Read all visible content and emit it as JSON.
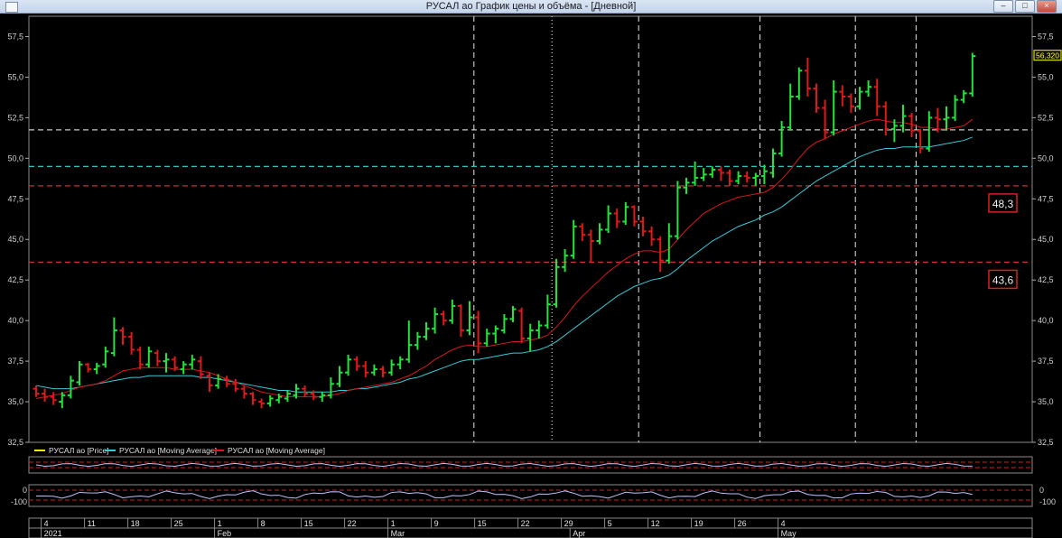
{
  "window": {
    "title": "РУСАЛ ао График цены и объёма - [Дневной]",
    "controls": [
      "–",
      "□",
      "×"
    ]
  },
  "colors": {
    "background": "#000000",
    "up": "#22e43a",
    "down": "#e01818",
    "ma_fast": "#d8191b",
    "ma_slow": "#38c9d8",
    "level_cyan": "#3ad8e0",
    "level_red": "#c83030",
    "level_grey": "#c8c8c8",
    "price_marker": "#ffff00"
  },
  "chart_data": {
    "type": "ohlc",
    "ylim": [
      32.5,
      58.75
    ],
    "yticks": [
      "57,5",
      "55,0",
      "52,5",
      "50,0",
      "47,5",
      "45,0",
      "42,5",
      "40,0",
      "37,5",
      "35,0",
      "32,5"
    ],
    "yticks_values": [
      57.5,
      55.0,
      52.5,
      50.0,
      47.5,
      45.0,
      42.5,
      40.0,
      37.5,
      35.0,
      32.5
    ],
    "last_price_label": "56,320",
    "last_price": 56.32,
    "bars": [
      {
        "o": 35.8,
        "h": 36.0,
        "l": 35.3,
        "c": 35.5
      },
      {
        "o": 35.5,
        "h": 35.8,
        "l": 35.0,
        "c": 35.3
      },
      {
        "o": 35.3,
        "h": 35.6,
        "l": 34.8,
        "c": 35.1
      },
      {
        "o": 35.0,
        "h": 35.6,
        "l": 34.6,
        "c": 35.4
      },
      {
        "o": 35.4,
        "h": 36.6,
        "l": 35.2,
        "c": 36.3
      },
      {
        "o": 36.2,
        "h": 37.5,
        "l": 36.0,
        "c": 37.3
      },
      {
        "o": 37.3,
        "h": 37.4,
        "l": 36.8,
        "c": 37.0
      },
      {
        "o": 37.0,
        "h": 37.4,
        "l": 36.7,
        "c": 37.2
      },
      {
        "o": 37.3,
        "h": 38.4,
        "l": 37.1,
        "c": 38.1
      },
      {
        "o": 38.0,
        "h": 40.2,
        "l": 37.8,
        "c": 39.4
      },
      {
        "o": 39.4,
        "h": 39.6,
        "l": 38.5,
        "c": 39.0
      },
      {
        "o": 39.0,
        "h": 39.3,
        "l": 37.9,
        "c": 38.2
      },
      {
        "o": 38.2,
        "h": 38.4,
        "l": 37.0,
        "c": 37.3
      },
      {
        "o": 37.3,
        "h": 38.4,
        "l": 37.1,
        "c": 38.1
      },
      {
        "o": 38.0,
        "h": 38.2,
        "l": 37.2,
        "c": 37.5
      },
      {
        "o": 37.5,
        "h": 38.0,
        "l": 36.8,
        "c": 37.6
      },
      {
        "o": 37.6,
        "h": 37.8,
        "l": 36.9,
        "c": 37.1
      },
      {
        "o": 37.0,
        "h": 37.5,
        "l": 36.7,
        "c": 37.3
      },
      {
        "o": 37.3,
        "h": 37.9,
        "l": 37.0,
        "c": 37.6
      },
      {
        "o": 37.5,
        "h": 37.8,
        "l": 36.4,
        "c": 36.7
      },
      {
        "o": 36.6,
        "h": 36.8,
        "l": 35.6,
        "c": 36.0
      },
      {
        "o": 36.0,
        "h": 36.7,
        "l": 35.8,
        "c": 36.4
      },
      {
        "o": 36.4,
        "h": 36.6,
        "l": 35.9,
        "c": 36.1
      },
      {
        "o": 36.1,
        "h": 36.4,
        "l": 35.6,
        "c": 35.8
      },
      {
        "o": 35.8,
        "h": 36.0,
        "l": 35.2,
        "c": 35.5
      },
      {
        "o": 35.5,
        "h": 35.6,
        "l": 34.8,
        "c": 35.1
      },
      {
        "o": 35.0,
        "h": 35.2,
        "l": 34.6,
        "c": 34.9
      },
      {
        "o": 34.9,
        "h": 35.4,
        "l": 34.7,
        "c": 35.2
      },
      {
        "o": 35.1,
        "h": 35.5,
        "l": 34.9,
        "c": 35.3
      },
      {
        "o": 35.2,
        "h": 35.7,
        "l": 35.0,
        "c": 35.5
      },
      {
        "o": 35.4,
        "h": 36.1,
        "l": 35.2,
        "c": 35.8
      },
      {
        "o": 35.8,
        "h": 36.0,
        "l": 35.3,
        "c": 35.5
      },
      {
        "o": 35.5,
        "h": 35.7,
        "l": 35.1,
        "c": 35.3
      },
      {
        "o": 35.3,
        "h": 35.6,
        "l": 35.0,
        "c": 35.4
      },
      {
        "o": 35.4,
        "h": 36.5,
        "l": 35.2,
        "c": 36.1
      },
      {
        "o": 36.1,
        "h": 37.2,
        "l": 35.9,
        "c": 36.8
      },
      {
        "o": 36.8,
        "h": 37.9,
        "l": 36.6,
        "c": 37.6
      },
      {
        "o": 37.6,
        "h": 37.8,
        "l": 36.9,
        "c": 37.2
      },
      {
        "o": 37.2,
        "h": 37.5,
        "l": 36.5,
        "c": 36.8
      },
      {
        "o": 36.8,
        "h": 37.3,
        "l": 36.6,
        "c": 37.0
      },
      {
        "o": 37.0,
        "h": 37.2,
        "l": 36.5,
        "c": 36.8
      },
      {
        "o": 36.8,
        "h": 37.6,
        "l": 36.6,
        "c": 37.3
      },
      {
        "o": 37.3,
        "h": 37.8,
        "l": 37.0,
        "c": 37.6
      },
      {
        "o": 37.6,
        "h": 40.0,
        "l": 37.4,
        "c": 38.5
      },
      {
        "o": 38.5,
        "h": 39.3,
        "l": 38.2,
        "c": 39.0
      },
      {
        "o": 39.0,
        "h": 39.9,
        "l": 38.8,
        "c": 39.5
      },
      {
        "o": 39.5,
        "h": 40.8,
        "l": 39.2,
        "c": 40.4
      },
      {
        "o": 40.4,
        "h": 40.6,
        "l": 39.7,
        "c": 40.0
      },
      {
        "o": 40.0,
        "h": 41.3,
        "l": 39.8,
        "c": 40.9
      },
      {
        "o": 40.9,
        "h": 41.0,
        "l": 39.0,
        "c": 39.4
      },
      {
        "o": 39.4,
        "h": 41.2,
        "l": 39.1,
        "c": 40.2
      },
      {
        "o": 40.2,
        "h": 40.6,
        "l": 38.0,
        "c": 38.6
      },
      {
        "o": 38.6,
        "h": 39.5,
        "l": 38.4,
        "c": 39.2
      },
      {
        "o": 39.2,
        "h": 39.7,
        "l": 38.6,
        "c": 39.5
      },
      {
        "o": 39.4,
        "h": 40.4,
        "l": 39.2,
        "c": 40.1
      },
      {
        "o": 40.1,
        "h": 40.9,
        "l": 39.9,
        "c": 40.7
      },
      {
        "o": 40.6,
        "h": 40.8,
        "l": 38.6,
        "c": 38.9
      },
      {
        "o": 38.9,
        "h": 39.8,
        "l": 38.1,
        "c": 39.4
      },
      {
        "o": 39.4,
        "h": 40.0,
        "l": 38.9,
        "c": 39.7
      },
      {
        "o": 39.7,
        "h": 41.6,
        "l": 39.5,
        "c": 41.0
      },
      {
        "o": 41.0,
        "h": 43.8,
        "l": 40.8,
        "c": 43.3
      },
      {
        "o": 43.3,
        "h": 44.4,
        "l": 43.0,
        "c": 44.0
      },
      {
        "o": 44.0,
        "h": 46.2,
        "l": 43.8,
        "c": 45.8
      },
      {
        "o": 45.8,
        "h": 46.0,
        "l": 44.9,
        "c": 45.3
      },
      {
        "o": 45.3,
        "h": 45.6,
        "l": 43.6,
        "c": 44.9
      },
      {
        "o": 44.9,
        "h": 46.0,
        "l": 44.7,
        "c": 45.6
      },
      {
        "o": 45.6,
        "h": 47.1,
        "l": 45.4,
        "c": 46.6
      },
      {
        "o": 46.6,
        "h": 46.9,
        "l": 45.7,
        "c": 46.1
      },
      {
        "o": 46.1,
        "h": 47.3,
        "l": 45.9,
        "c": 47.0
      },
      {
        "o": 47.0,
        "h": 47.1,
        "l": 45.8,
        "c": 46.1
      },
      {
        "o": 46.1,
        "h": 46.4,
        "l": 45.2,
        "c": 45.5
      },
      {
        "o": 45.5,
        "h": 45.8,
        "l": 44.6,
        "c": 45.0
      },
      {
        "o": 45.0,
        "h": 45.2,
        "l": 43.0,
        "c": 43.7
      },
      {
        "o": 43.7,
        "h": 46.0,
        "l": 43.5,
        "c": 45.2
      },
      {
        "o": 45.2,
        "h": 48.6,
        "l": 45.0,
        "c": 48.2
      },
      {
        "o": 48.2,
        "h": 48.8,
        "l": 47.8,
        "c": 48.5
      },
      {
        "o": 48.5,
        "h": 49.8,
        "l": 48.3,
        "c": 48.8
      },
      {
        "o": 48.8,
        "h": 49.4,
        "l": 48.6,
        "c": 49.0
      },
      {
        "o": 49.0,
        "h": 49.5,
        "l": 48.8,
        "c": 49.3
      },
      {
        "o": 49.3,
        "h": 49.5,
        "l": 48.6,
        "c": 49.1
      },
      {
        "o": 49.1,
        "h": 49.3,
        "l": 48.3,
        "c": 48.6
      },
      {
        "o": 48.6,
        "h": 49.2,
        "l": 48.4,
        "c": 48.9
      },
      {
        "o": 48.9,
        "h": 49.2,
        "l": 48.5,
        "c": 48.8
      },
      {
        "o": 48.8,
        "h": 49.1,
        "l": 48.3,
        "c": 48.9
      },
      {
        "o": 48.9,
        "h": 49.6,
        "l": 48.4,
        "c": 49.2
      },
      {
        "o": 49.1,
        "h": 50.6,
        "l": 48.8,
        "c": 50.3
      },
      {
        "o": 50.3,
        "h": 52.3,
        "l": 50.1,
        "c": 51.9
      },
      {
        "o": 51.9,
        "h": 54.6,
        "l": 51.7,
        "c": 53.8
      },
      {
        "o": 53.8,
        "h": 55.6,
        "l": 53.6,
        "c": 55.4
      },
      {
        "o": 55.4,
        "h": 56.2,
        "l": 53.8,
        "c": 54.3
      },
      {
        "o": 54.3,
        "h": 54.6,
        "l": 52.8,
        "c": 53.1
      },
      {
        "o": 53.1,
        "h": 53.6,
        "l": 51.2,
        "c": 51.6
      },
      {
        "o": 51.6,
        "h": 54.8,
        "l": 51.4,
        "c": 54.1
      },
      {
        "o": 54.1,
        "h": 54.5,
        "l": 53.2,
        "c": 53.8
      },
      {
        "o": 53.8,
        "h": 54.0,
        "l": 52.8,
        "c": 53.2
      },
      {
        "o": 53.2,
        "h": 54.4,
        "l": 53.0,
        "c": 54.1
      },
      {
        "o": 54.1,
        "h": 54.8,
        "l": 53.8,
        "c": 54.4
      },
      {
        "o": 54.4,
        "h": 54.9,
        "l": 52.6,
        "c": 53.2
      },
      {
        "o": 53.2,
        "h": 53.5,
        "l": 51.4,
        "c": 51.8
      },
      {
        "o": 51.8,
        "h": 52.4,
        "l": 51.0,
        "c": 52.0
      },
      {
        "o": 52.0,
        "h": 53.3,
        "l": 51.6,
        "c": 52.6
      },
      {
        "o": 52.6,
        "h": 52.8,
        "l": 51.3,
        "c": 51.7
      },
      {
        "o": 51.7,
        "h": 51.8,
        "l": 50.3,
        "c": 50.6
      },
      {
        "o": 50.6,
        "h": 52.9,
        "l": 50.4,
        "c": 52.5
      },
      {
        "o": 52.5,
        "h": 53.1,
        "l": 51.6,
        "c": 52.4
      },
      {
        "o": 52.4,
        "h": 53.2,
        "l": 51.7,
        "c": 52.5
      },
      {
        "o": 52.5,
        "h": 53.9,
        "l": 52.3,
        "c": 53.6
      },
      {
        "o": 53.6,
        "h": 54.2,
        "l": 53.4,
        "c": 54.0
      },
      {
        "o": 54.0,
        "h": 56.5,
        "l": 53.8,
        "c": 56.3
      }
    ],
    "ma_fast": [
      35.2,
      35.3,
      35.4,
      35.5,
      35.7,
      35.9,
      36.0,
      36.1,
      36.3,
      36.6,
      36.9,
      37.0,
      37.1,
      37.1,
      37.1,
      37.1,
      37.0,
      37.0,
      37.0,
      36.9,
      36.8,
      36.6,
      36.4,
      36.2,
      36.0,
      35.8,
      35.6,
      35.5,
      35.4,
      35.3,
      35.3,
      35.3,
      35.3,
      35.3,
      35.4,
      35.5,
      35.7,
      35.8,
      35.9,
      36.0,
      36.1,
      36.2,
      36.4,
      36.6,
      36.9,
      37.2,
      37.6,
      37.9,
      38.2,
      38.4,
      38.5,
      38.4,
      38.4,
      38.5,
      38.6,
      38.7,
      38.7,
      38.8,
      38.9,
      39.1,
      39.6,
      40.2,
      40.9,
      41.5,
      42.0,
      42.5,
      43.0,
      43.4,
      43.8,
      44.1,
      44.3,
      44.3,
      44.2,
      44.4,
      45.0,
      45.6,
      46.1,
      46.6,
      46.9,
      47.2,
      47.4,
      47.6,
      47.7,
      47.8,
      47.9,
      48.2,
      48.7,
      49.3,
      50.0,
      50.6,
      51.0,
      51.2,
      51.5,
      51.7,
      51.9,
      52.1,
      52.3,
      52.4,
      52.3,
      52.2,
      52.2,
      52.1,
      51.9,
      51.9,
      51.8,
      51.8,
      51.9,
      52.0,
      52.4
    ],
    "ma_slow": [
      36.0,
      35.9,
      35.8,
      35.8,
      35.8,
      35.9,
      36.0,
      36.1,
      36.2,
      36.3,
      36.4,
      36.5,
      36.5,
      36.6,
      36.6,
      36.6,
      36.6,
      36.6,
      36.6,
      36.5,
      36.5,
      36.4,
      36.3,
      36.2,
      36.1,
      36.0,
      35.9,
      35.8,
      35.7,
      35.7,
      35.6,
      35.6,
      35.6,
      35.6,
      35.6,
      35.7,
      35.7,
      35.8,
      35.8,
      35.9,
      36.0,
      36.1,
      36.2,
      36.4,
      36.5,
      36.7,
      36.9,
      37.1,
      37.3,
      37.5,
      37.6,
      37.6,
      37.7,
      37.8,
      37.9,
      38.0,
      38.0,
      38.1,
      38.2,
      38.4,
      38.7,
      39.1,
      39.5,
      39.9,
      40.3,
      40.7,
      41.1,
      41.5,
      41.8,
      42.1,
      42.3,
      42.5,
      42.6,
      42.8,
      43.2,
      43.7,
      44.1,
      44.5,
      44.9,
      45.2,
      45.5,
      45.8,
      46.0,
      46.2,
      46.5,
      46.7,
      47.0,
      47.4,
      47.8,
      48.2,
      48.6,
      48.9,
      49.2,
      49.5,
      49.8,
      50.1,
      50.3,
      50.5,
      50.6,
      50.6,
      50.7,
      50.7,
      50.7,
      50.7,
      50.8,
      50.9,
      51.0,
      51.1,
      51.3
    ],
    "hlines": [
      {
        "y": 51.75,
        "color": "grey",
        "label": ""
      },
      {
        "y": 49.5,
        "color": "cyan",
        "label": ""
      },
      {
        "y": 48.3,
        "color": "red",
        "label": "48,3"
      },
      {
        "y": 43.6,
        "color": "red",
        "label": "43,6"
      }
    ],
    "vlines_after_bar": [
      50,
      83,
      101
    ],
    "vlines_white_dashed_after_bar": [
      69,
      94
    ],
    "vline_grey_dotted_after_bar": 59,
    "legend": [
      {
        "name": "РУСАЛ ао [Price]",
        "color": "#f0f000"
      },
      {
        "name": "РУСАЛ ао [Moving Average]",
        "color": "#38c9d8"
      },
      {
        "name": "РУСАЛ ао [Moving Average]",
        "color": "#d8191b"
      }
    ],
    "oscillator": {
      "labels": [
        "0",
        "-100"
      ]
    },
    "x_axis": {
      "day_labels": [
        {
          "bar": 1,
          "text": "4"
        },
        {
          "bar": 6,
          "text": "11"
        },
        {
          "bar": 11,
          "text": "18"
        },
        {
          "bar": 16,
          "text": "25"
        },
        {
          "bar": 21,
          "text": "1"
        },
        {
          "bar": 26,
          "text": "8"
        },
        {
          "bar": 31,
          "text": "15"
        },
        {
          "bar": 36,
          "text": "22"
        },
        {
          "bar": 41,
          "text": "1"
        },
        {
          "bar": 46,
          "text": "9"
        },
        {
          "bar": 51,
          "text": "15"
        },
        {
          "bar": 56,
          "text": "22"
        },
        {
          "bar": 61,
          "text": "29"
        },
        {
          "bar": 66,
          "text": "5"
        },
        {
          "bar": 71,
          "text": "12"
        },
        {
          "bar": 76,
          "text": "19"
        },
        {
          "bar": 81,
          "text": "26"
        },
        {
          "bar": 86,
          "text": "4"
        }
      ],
      "month_labels": [
        {
          "bar": 1,
          "text": "2021"
        },
        {
          "bar": 21,
          "text": "Feb"
        },
        {
          "bar": 41,
          "text": "Mar"
        },
        {
          "bar": 62,
          "text": "Apr"
        },
        {
          "bar": 86,
          "text": "May"
        }
      ]
    }
  }
}
